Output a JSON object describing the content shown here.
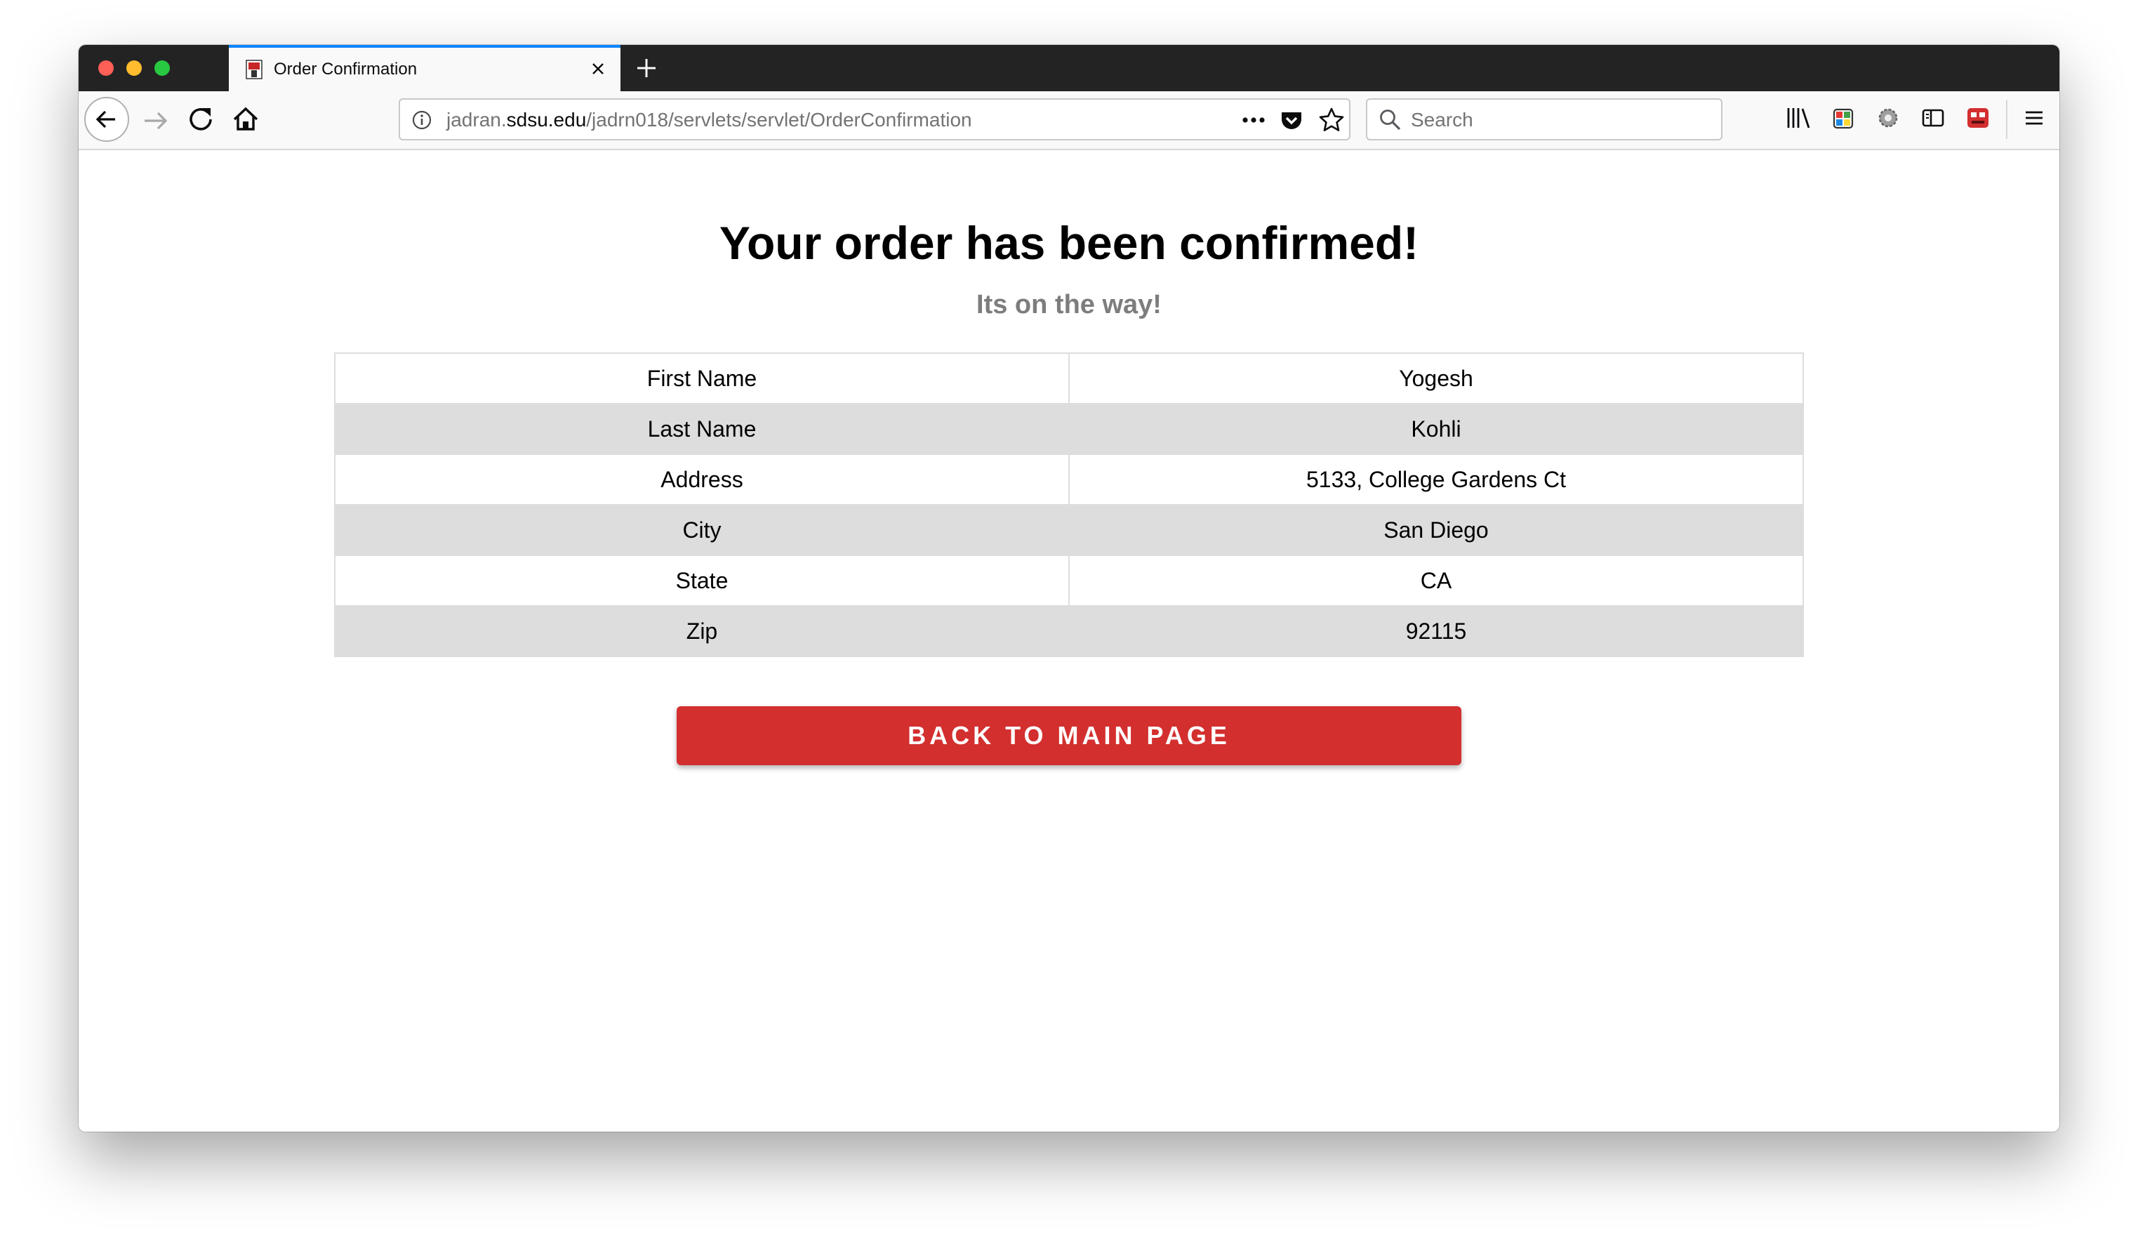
{
  "browser": {
    "tab": {
      "title": "Order Confirmation"
    },
    "url": {
      "prefix": "jadran.",
      "host": "sdsu.edu",
      "path": "/jadrn018/servlets/servlet/OrderConfirmation"
    },
    "search": {
      "placeholder": "Search"
    }
  },
  "page": {
    "title": "Your order has been confirmed!",
    "subtitle": "Its on the way!",
    "order_details": [
      {
        "label": "First Name",
        "value": "Yogesh"
      },
      {
        "label": "Last Name",
        "value": "Kohli"
      },
      {
        "label": "Address",
        "value": "5133, College Gardens Ct"
      },
      {
        "label": "City",
        "value": "San Diego"
      },
      {
        "label": "State",
        "value": "CA"
      },
      {
        "label": "Zip",
        "value": "92115"
      }
    ],
    "back_button_label": "BACK TO MAIN PAGE"
  },
  "colors": {
    "accent_button": "#d32f2f",
    "row_stripe": "#dddddd",
    "subtitle": "#7d7d7d",
    "tab_highlight": "#0a84ff"
  }
}
